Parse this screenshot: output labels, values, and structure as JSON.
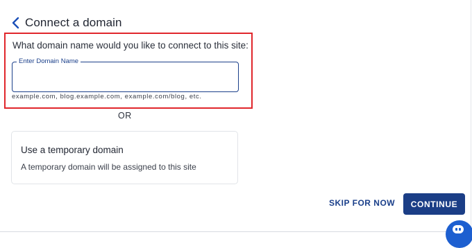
{
  "header": {
    "back_icon": "chevron-left-icon",
    "title": "Connect a domain"
  },
  "domain_form": {
    "question": "What domain name would you like to connect to this site:",
    "field_label": "Enter Domain Name",
    "field_value": "",
    "hint": "example.com, blog.example.com, example.com/blog, etc."
  },
  "separator": "OR",
  "temporary_option": {
    "title": "Use a temporary domain",
    "description": "A temporary domain will be assigned to this site"
  },
  "actions": {
    "skip_label": "SKIP FOR NOW",
    "continue_label": "CONTINUE"
  },
  "chat": {
    "icon": "chat-bubble-icon"
  },
  "colors": {
    "accent": "#1b3e86",
    "highlight": "#e0262b",
    "chat": "#1d5fd0"
  }
}
